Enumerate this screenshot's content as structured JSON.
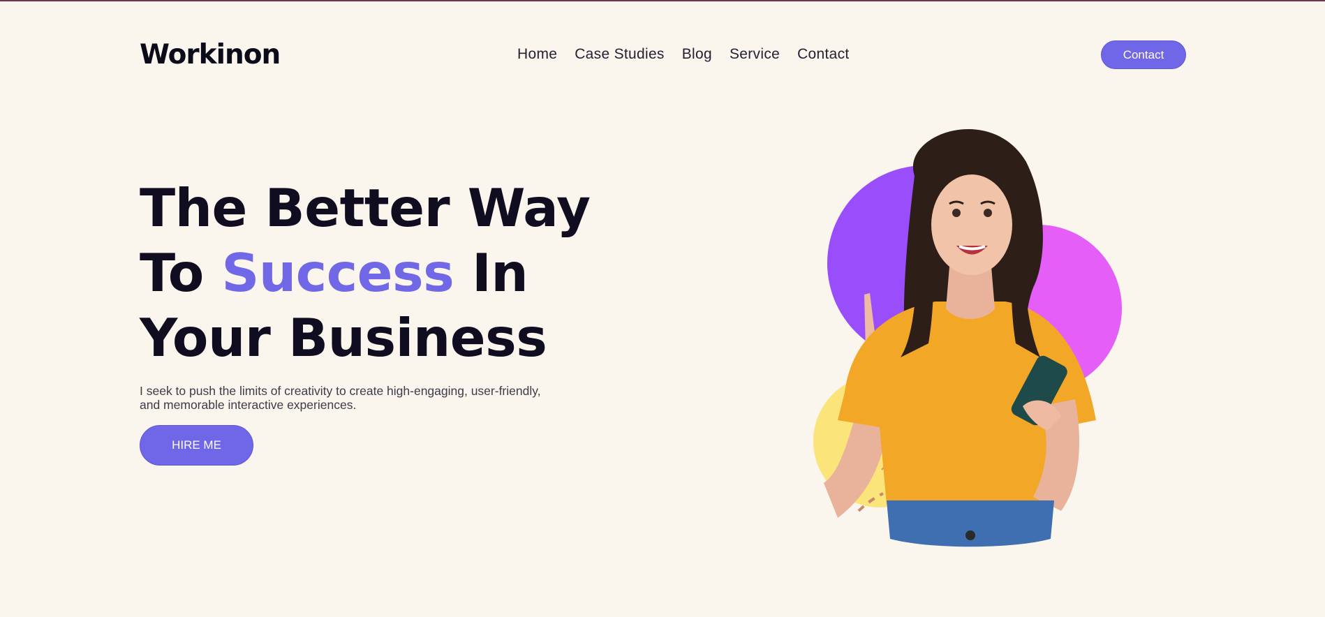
{
  "header": {
    "logo": "Workinon",
    "nav": [
      "Home",
      "Case Studies",
      "Blog",
      "Service",
      "Contact"
    ],
    "cta_label": "Contact"
  },
  "hero": {
    "title_line1": "The Better Way",
    "title_line2_pre": "To ",
    "title_line2_accent": "Success",
    "title_line2_post": " In",
    "title_line3": "Your Business",
    "description_line1": "I seek to push the limits of creativity to create high-engaging, user-friendly,",
    "description_line2": "and memorable interactive experiences.",
    "cta_label": "HIRE ME"
  },
  "colors": {
    "background": "#faf6ed",
    "accent": "#7066e8",
    "heading": "#0f0d1f",
    "circle_purple": "#9a4dfb",
    "circle_magenta": "#e45ef7",
    "circle_yellow": "#fbe47a",
    "shirt": "#f2a726"
  }
}
